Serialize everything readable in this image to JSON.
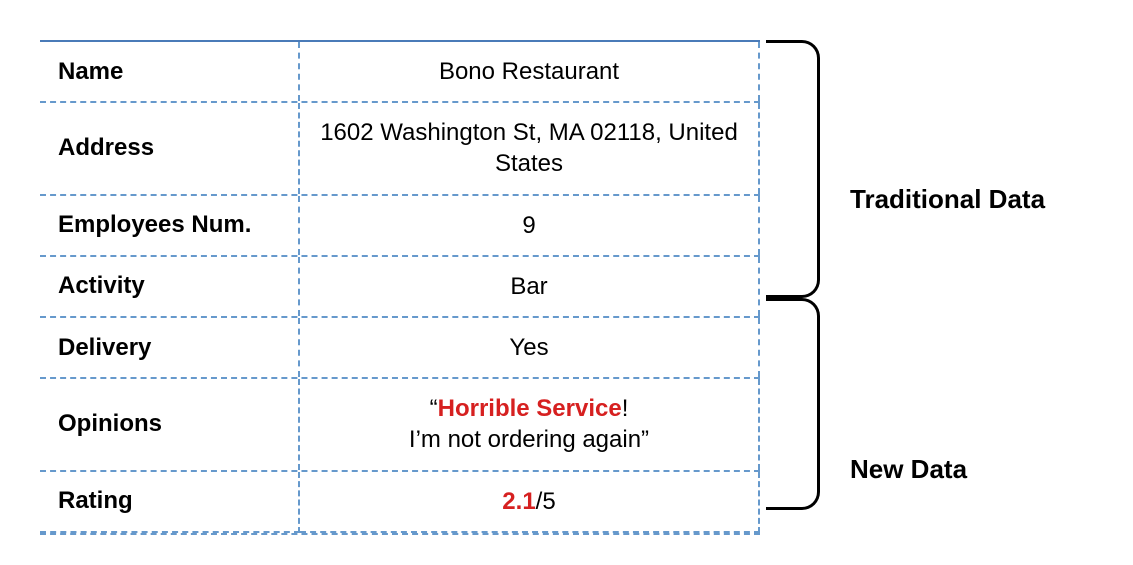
{
  "rows": [
    {
      "label": "Name",
      "value": "Bono Restaurant"
    },
    {
      "label": "Address",
      "value": "1602 Washington St, MA 02118, United States"
    },
    {
      "label": "Employees Num.",
      "value": "9"
    },
    {
      "label": "Activity",
      "value": "Bar"
    },
    {
      "label": "Delivery",
      "value": "Yes"
    }
  ],
  "opinions": {
    "label": "Opinions",
    "quote_open": "“",
    "highlight": "Horrible Service",
    "after_highlight": "!",
    "line2": "I’m not ordering again”"
  },
  "rating": {
    "label": "Rating",
    "score": "2.1",
    "suffix": "/5"
  },
  "groups": {
    "traditional": "Traditional Data",
    "newdata": "New Data"
  }
}
